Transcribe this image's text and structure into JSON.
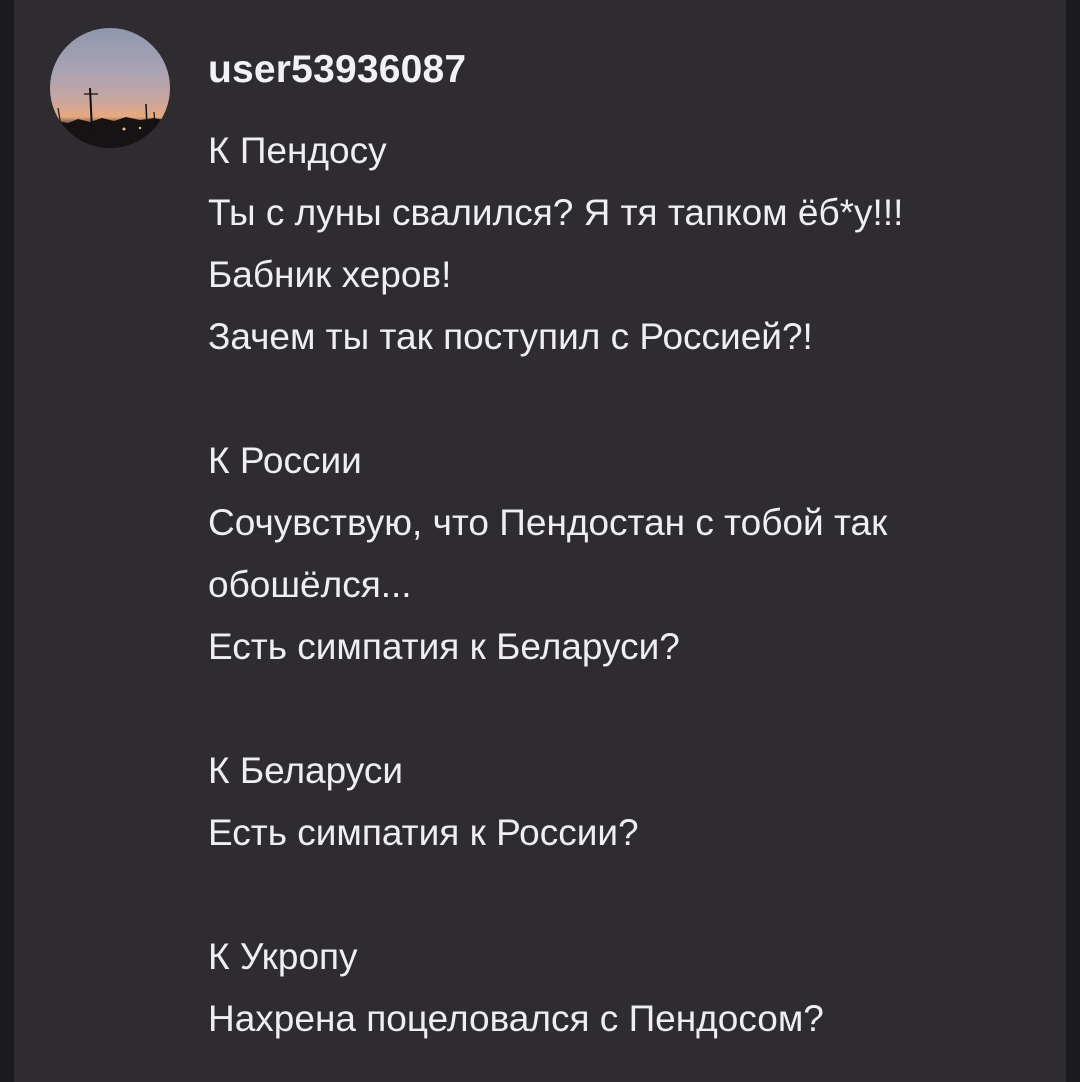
{
  "comment": {
    "username": "user53936087",
    "lines": [
      "К Пендосу",
      "Ты с луны свалился? Я тя тапком ёб*у!!!",
      "Бабник херов!",
      "Зачем ты так поступил с Россией?!",
      "",
      "К России",
      "Сочувствую, что Пендостан с тобой так",
      "обошёлся...",
      "Есть симпатия к Беларуси?",
      "",
      "К Беларуси",
      "Есть симпатия к России?",
      "",
      "К Укропу",
      "Нахрена поцеловался с Пендосом?"
    ]
  }
}
